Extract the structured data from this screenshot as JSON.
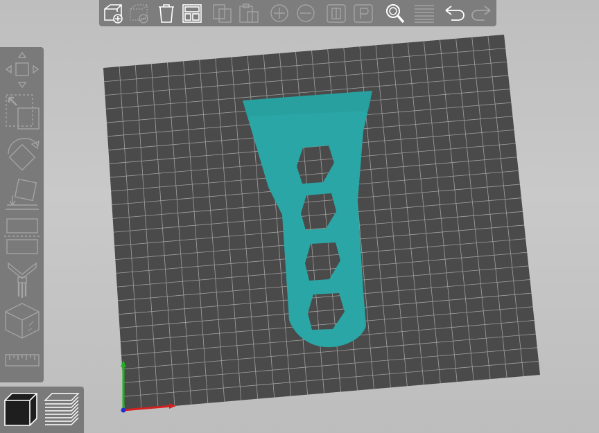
{
  "app": {
    "view": "3D build plate"
  },
  "colors": {
    "background": "#c4c4c4",
    "toolbar": "#7d7d7d",
    "icon_enabled": "#ffffff",
    "icon_disabled": "#a4a4a4",
    "build_plate": "#4a4a4a",
    "grid_line": "#bdbdbd",
    "model": "#2aa6a6",
    "axis_x": "#d42020",
    "axis_y": "#1fb41f",
    "axis_z": "#2030d0"
  },
  "top_toolbar": {
    "buttons": [
      {
        "icon": "add-object-icon",
        "enabled": true
      },
      {
        "icon": "delete-object-icon",
        "enabled": false
      },
      {
        "icon": "delete-all-icon",
        "enabled": true
      },
      {
        "icon": "arrange-icon",
        "enabled": true
      },
      {
        "icon": "copy-icon",
        "enabled": false
      },
      {
        "icon": "paste-icon",
        "enabled": false
      },
      {
        "icon": "add-instance-icon",
        "enabled": false
      },
      {
        "icon": "remove-instance-icon",
        "enabled": false
      },
      {
        "icon": "split-objects-icon",
        "enabled": false
      },
      {
        "icon": "split-parts-icon",
        "enabled": false
      },
      {
        "icon": "search-icon",
        "enabled": true
      },
      {
        "icon": "layers-editing-icon",
        "enabled": false
      },
      {
        "icon": "undo-icon",
        "enabled": true
      },
      {
        "icon": "redo-icon",
        "enabled": false
      }
    ]
  },
  "left_toolbar": {
    "tools": [
      {
        "icon": "move-icon",
        "enabled": false
      },
      {
        "icon": "scale-icon",
        "enabled": false
      },
      {
        "icon": "rotate-icon",
        "enabled": false
      },
      {
        "icon": "place-on-face-icon",
        "enabled": false
      },
      {
        "icon": "cut-icon",
        "enabled": false
      },
      {
        "icon": "paint-supports-icon",
        "enabled": false
      },
      {
        "icon": "seam-painting-icon",
        "enabled": false
      },
      {
        "icon": "measure-icon",
        "enabled": false
      }
    ]
  },
  "view_mode": {
    "buttons": [
      {
        "icon": "3d-view-icon",
        "selected": true
      },
      {
        "icon": "preview-layers-icon",
        "selected": false
      }
    ]
  }
}
